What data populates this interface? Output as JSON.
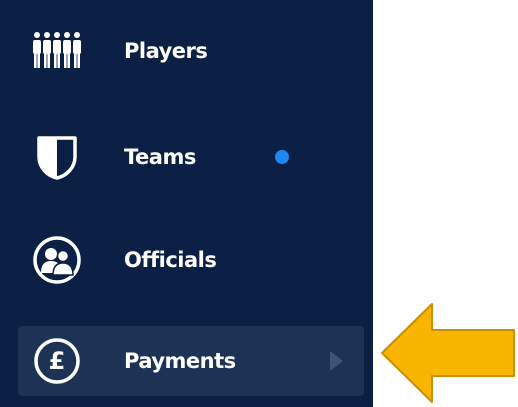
{
  "sidebar": {
    "items": [
      {
        "label": "Players",
        "icon": "players-icon"
      },
      {
        "label": "Teams",
        "icon": "shield-icon",
        "notification_dot": true
      },
      {
        "label": "Officials",
        "icon": "officials-icon"
      },
      {
        "label": "Payments",
        "icon": "pound-icon",
        "selected": true,
        "has_chevron": true
      }
    ]
  },
  "colors": {
    "sidebar_background": "#0c1f44",
    "selected_background": "#1d3254",
    "text": "#ffffff",
    "notification_dot": "#1e88f0",
    "chevron": "#3c5478",
    "pointer_arrow": "#f7b500",
    "pointer_arrow_outline": "#c98f00"
  },
  "annotation": {
    "pointer_arrow": "arrow-pointing-left"
  }
}
